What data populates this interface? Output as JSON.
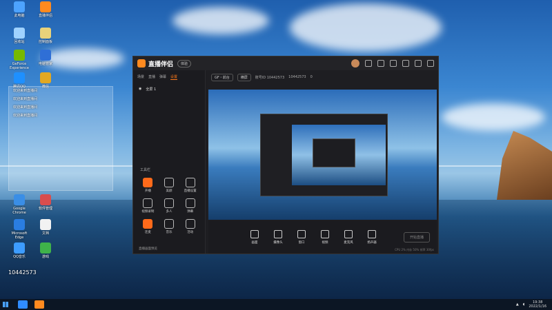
{
  "desktop": {
    "icons": [
      {
        "label": "此电脑"
      },
      {
        "label": "直播伴侣"
      },
      {
        "label": "回收站"
      },
      {
        "label": "控制面板"
      },
      {
        "label": "GeForce Experience"
      },
      {
        "label": "电脑管家"
      },
      {
        "label": "腾讯QQ"
      },
      {
        "label": "微信"
      },
      {
        "label": "Google Chrome"
      },
      {
        "label": "软件管理"
      },
      {
        "label": "Microsoft Edge"
      },
      {
        "label": "文档"
      },
      {
        "label": "QQ音乐"
      },
      {
        "label": "游戏"
      }
    ]
  },
  "chat": {
    "lines": [
      "欢迎来到直播间",
      "欢迎来到直播间",
      "欢迎来到直播间",
      "欢迎来到直播间"
    ]
  },
  "app": {
    "title": "直播伴侣",
    "badge": "体验",
    "tabs": [
      "场景",
      "直播",
      "弹幕",
      "设置"
    ],
    "active_tab": 3,
    "scene_label": "全屏 1",
    "tools_title": "工具栏",
    "tools": [
      {
        "label": "开播"
      },
      {
        "label": "美颜"
      },
      {
        "label": "直播设置"
      },
      {
        "label": "视频录制"
      },
      {
        "label": "多人"
      },
      {
        "label": "弹幕"
      },
      {
        "label": "连麦"
      },
      {
        "label": "音乐"
      },
      {
        "label": "活动"
      }
    ],
    "hint": "直播画面预览",
    "subbar": {
      "pill1": "GF・前台",
      "pill2": "横屏",
      "id_text": "账号ID 10442573",
      "viewers": "10442573",
      "likes": "0"
    },
    "controls": [
      {
        "label": "画面"
      },
      {
        "label": "摄像头"
      },
      {
        "label": "窗口"
      },
      {
        "label": "视频"
      },
      {
        "label": "麦克风"
      },
      {
        "label": "扬声器"
      }
    ],
    "start_button": "开始直播",
    "status": "CPU 2% 内存 50% 帧率 30fps"
  },
  "streamer_tag": "10442573",
  "taskbar": {
    "time": "19:38",
    "date": "2022/1/16"
  }
}
